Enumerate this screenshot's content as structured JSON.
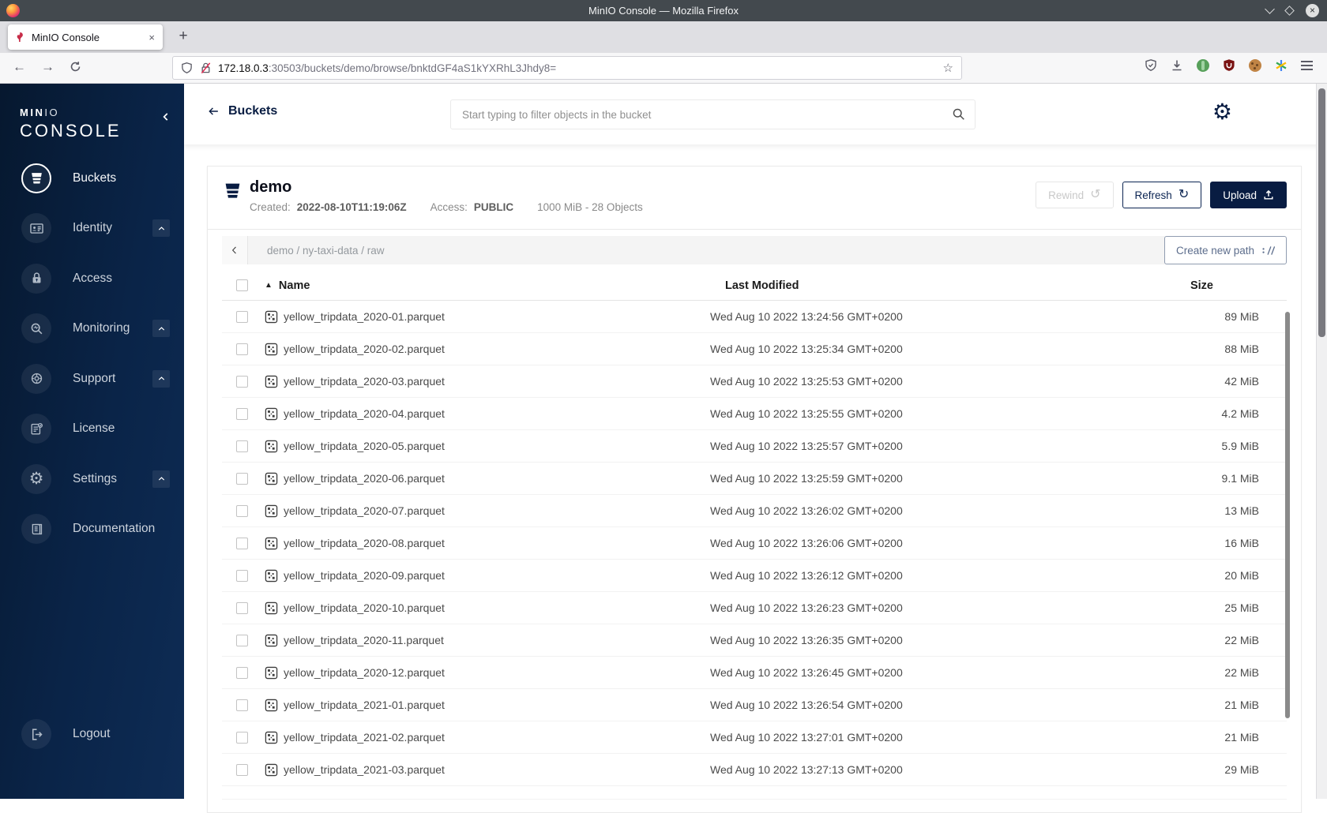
{
  "browser": {
    "window_title": "MinIO Console — Mozilla Firefox",
    "tab": {
      "title": "MinIO Console"
    },
    "new_tab_label": "+",
    "url": {
      "host": "172.18.0.3",
      "rest": ":30503/buckets/demo/browse/bnktdGF4aS1kYXRhL3Jhdy8="
    }
  },
  "sidebar": {
    "logo_min": "MIN",
    "logo_io": "IO",
    "logo_console": "CONSOLE",
    "items": [
      {
        "label": "Buckets",
        "icon": "bucket-icon",
        "active": true,
        "expandable": false
      },
      {
        "label": "Identity",
        "icon": "identity-icon",
        "active": false,
        "expandable": true
      },
      {
        "label": "Access",
        "icon": "access-icon",
        "active": false,
        "expandable": false
      },
      {
        "label": "Monitoring",
        "icon": "monitoring-icon",
        "active": false,
        "expandable": true
      },
      {
        "label": "Support",
        "icon": "support-icon",
        "active": false,
        "expandable": true
      },
      {
        "label": "License",
        "icon": "license-icon",
        "active": false,
        "expandable": false
      },
      {
        "label": "Settings",
        "icon": "settings-icon",
        "active": false,
        "expandable": true
      },
      {
        "label": "Documentation",
        "icon": "documentation-icon",
        "active": false,
        "expandable": false
      }
    ],
    "logout_label": "Logout"
  },
  "header": {
    "back_label": "Buckets",
    "search_placeholder": "Start typing to filter objects in the bucket"
  },
  "bucket": {
    "name": "demo",
    "created_label": "Created:",
    "created_value": "2022-08-10T11:19:06Z",
    "access_label": "Access:",
    "access_value": "PUBLIC",
    "summary": "1000 MiB - 28 Objects",
    "actions": {
      "rewind": "Rewind",
      "refresh": "Refresh",
      "upload": "Upload"
    }
  },
  "browse": {
    "path_segments": [
      "demo",
      "ny-taxi-data",
      "raw"
    ],
    "path_display": "demo / ny-taxi-data / raw",
    "create_path_label": "Create new path",
    "columns": {
      "name": "Name",
      "modified": "Last Modified",
      "size": "Size"
    },
    "rows": [
      {
        "name": "yellow_tripdata_2020-01.parquet",
        "modified": "Wed Aug 10 2022 13:24:56 GMT+0200",
        "size": "89 MiB"
      },
      {
        "name": "yellow_tripdata_2020-02.parquet",
        "modified": "Wed Aug 10 2022 13:25:34 GMT+0200",
        "size": "88 MiB"
      },
      {
        "name": "yellow_tripdata_2020-03.parquet",
        "modified": "Wed Aug 10 2022 13:25:53 GMT+0200",
        "size": "42 MiB"
      },
      {
        "name": "yellow_tripdata_2020-04.parquet",
        "modified": "Wed Aug 10 2022 13:25:55 GMT+0200",
        "size": "4.2 MiB"
      },
      {
        "name": "yellow_tripdata_2020-05.parquet",
        "modified": "Wed Aug 10 2022 13:25:57 GMT+0200",
        "size": "5.9 MiB"
      },
      {
        "name": "yellow_tripdata_2020-06.parquet",
        "modified": "Wed Aug 10 2022 13:25:59 GMT+0200",
        "size": "9.1 MiB"
      },
      {
        "name": "yellow_tripdata_2020-07.parquet",
        "modified": "Wed Aug 10 2022 13:26:02 GMT+0200",
        "size": "13 MiB"
      },
      {
        "name": "yellow_tripdata_2020-08.parquet",
        "modified": "Wed Aug 10 2022 13:26:06 GMT+0200",
        "size": "16 MiB"
      },
      {
        "name": "yellow_tripdata_2020-09.parquet",
        "modified": "Wed Aug 10 2022 13:26:12 GMT+0200",
        "size": "20 MiB"
      },
      {
        "name": "yellow_tripdata_2020-10.parquet",
        "modified": "Wed Aug 10 2022 13:26:23 GMT+0200",
        "size": "25 MiB"
      },
      {
        "name": "yellow_tripdata_2020-11.parquet",
        "modified": "Wed Aug 10 2022 13:26:35 GMT+0200",
        "size": "22 MiB"
      },
      {
        "name": "yellow_tripdata_2020-12.parquet",
        "modified": "Wed Aug 10 2022 13:26:45 GMT+0200",
        "size": "22 MiB"
      },
      {
        "name": "yellow_tripdata_2021-01.parquet",
        "modified": "Wed Aug 10 2022 13:26:54 GMT+0200",
        "size": "21 MiB"
      },
      {
        "name": "yellow_tripdata_2021-02.parquet",
        "modified": "Wed Aug 10 2022 13:27:01 GMT+0200",
        "size": "21 MiB"
      },
      {
        "name": "yellow_tripdata_2021-03.parquet",
        "modified": "Wed Aug 10 2022 13:27:13 GMT+0200",
        "size": "29 MiB"
      }
    ]
  },
  "colors": {
    "accent": "#081C42",
    "minio_red": "#C72C48",
    "sidebar_top": "#06182f",
    "sidebar_bottom": "#0e2c55"
  }
}
